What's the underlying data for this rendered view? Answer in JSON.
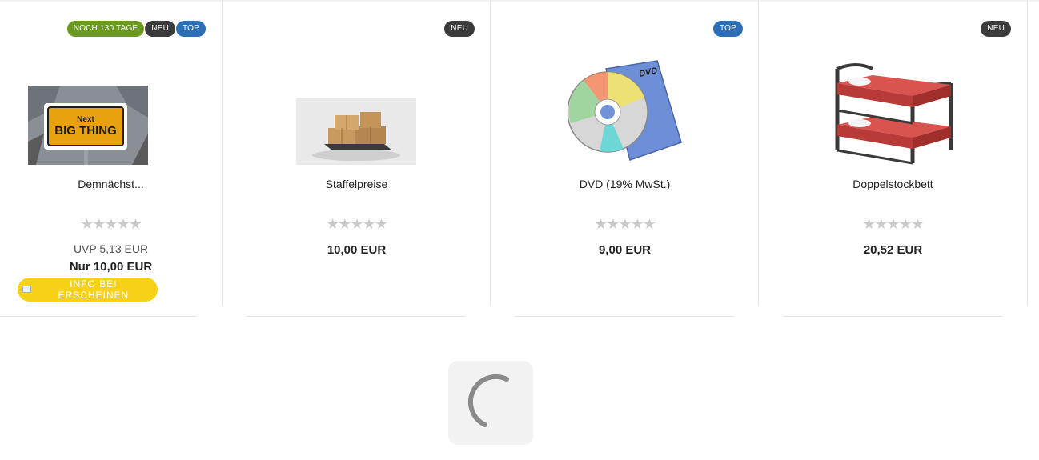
{
  "products": [
    {
      "name": "Demnächst...",
      "badges": [
        {
          "text": "NOCH 130 TAGE",
          "color": "#6a9a1f"
        },
        {
          "text": "NEU",
          "color": "#3b3b3b"
        },
        {
          "text": "TOP",
          "color": "#2d6fb4"
        }
      ],
      "image_alt": "Next BIG THING",
      "image_sign_line1": "Next",
      "image_sign_line2": "BIG THING",
      "rating_stars": "★★★★★",
      "uvp": "UVP 5,13 EUR",
      "price": "Nur 10,00 EUR",
      "cta": "INFO BEI ERSCHEINEN"
    },
    {
      "name": "Staffelpreise",
      "badges": [
        {
          "text": "NEU",
          "color": "#3b3b3b"
        }
      ],
      "rating_stars": "★★★★★",
      "price": "10,00 EUR"
    },
    {
      "name": "DVD (19% MwSt.)",
      "badges": [
        {
          "text": "TOP",
          "color": "#2d6fb4"
        }
      ],
      "image_label": "DVD",
      "rating_stars": "★★★★★",
      "price": "9,00 EUR"
    },
    {
      "name": "Doppelstockbett",
      "badges": [
        {
          "text": "NEU",
          "color": "#3b3b3b"
        }
      ],
      "rating_stars": "★★★★★",
      "price": "20,52 EUR"
    }
  ],
  "loader": {
    "icon": "spinner-icon"
  }
}
